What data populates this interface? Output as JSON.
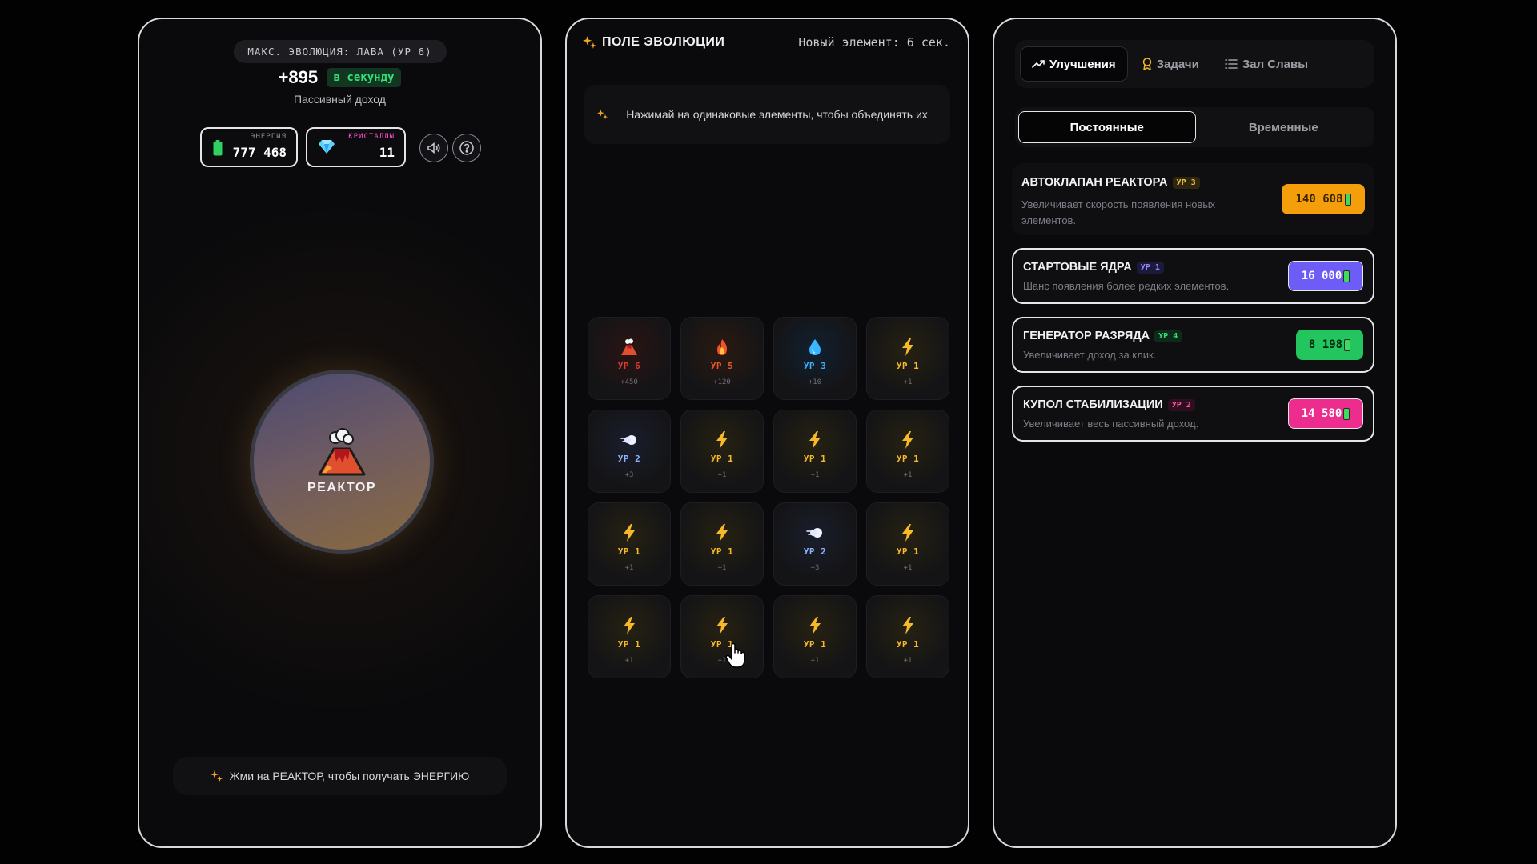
{
  "left": {
    "max_evolution": "МАКС. ЭВОЛЮЦИЯ: ЛАВА (УР 6)",
    "rate_value": "+895",
    "rate_badge": "в секунду",
    "passive_label": "Пассивный доход",
    "energy": {
      "label": "ЭНЕРГИЯ",
      "value": "777 468",
      "icon": "battery-icon"
    },
    "crystals": {
      "label": "КРИСТАЛЛЫ",
      "value": "11",
      "icon": "diamond-icon"
    },
    "reactor_label": "РЕАКТОР",
    "reactor_icon": "volcano-icon",
    "hint": "Жми на РЕАКТОР, чтобы получать ЭНЕРГИЮ"
  },
  "mid": {
    "title": "ПОЛЕ ЭВОЛЮЦИИ",
    "timer": "Новый элемент: 6 сек.",
    "hint": "Нажимай на одинаковые элементы, чтобы объединять их",
    "cells": [
      {
        "type": "lava",
        "level": "УР 6",
        "inc": "+450"
      },
      {
        "type": "fire",
        "level": "УР 5",
        "inc": "+120"
      },
      {
        "type": "water",
        "level": "УР 3",
        "inc": "+10"
      },
      {
        "type": "bolt",
        "level": "УР 1",
        "inc": "+1"
      },
      {
        "type": "wind",
        "level": "УР 2",
        "inc": "+3"
      },
      {
        "type": "bolt",
        "level": "УР 1",
        "inc": "+1"
      },
      {
        "type": "bolt",
        "level": "УР 1",
        "inc": "+1"
      },
      {
        "type": "bolt",
        "level": "УР 1",
        "inc": "+1"
      },
      {
        "type": "bolt",
        "level": "УР 1",
        "inc": "+1"
      },
      {
        "type": "bolt",
        "level": "УР 1",
        "inc": "+1"
      },
      {
        "type": "wind",
        "level": "УР 2",
        "inc": "+3"
      },
      {
        "type": "bolt",
        "level": "УР 1",
        "inc": "+1"
      },
      {
        "type": "bolt",
        "level": "УР 1",
        "inc": "+1"
      },
      {
        "type": "bolt",
        "level": "УР 1",
        "inc": "+1"
      },
      {
        "type": "bolt",
        "level": "УР 1",
        "inc": "+1"
      },
      {
        "type": "bolt",
        "level": "УР 1",
        "inc": "+1"
      }
    ]
  },
  "right": {
    "tabs": [
      "Улучшения",
      "Задачи",
      "Зал Славы"
    ],
    "segments": [
      "Постоянные",
      "Временные"
    ],
    "upgrades": [
      {
        "name": "АВТОКЛАПАН РЕАКТОРА",
        "level": "УР 3",
        "desc": "Увеличивает скорость появления новых элементов.",
        "price": "140 608",
        "color": "#f59e0b",
        "tag_color": "#f5c542"
      },
      {
        "name": "СТАРТОВЫЕ ЯДРА",
        "level": "УР 1",
        "desc": "Шанс появления более редких элементов.",
        "price": "16 000",
        "color": "#6d5cf6",
        "tag_color": "#8f86ff"
      },
      {
        "name": "ГЕНЕРАТОР РАЗРЯДА",
        "level": "УР 4",
        "desc": "Увеличивает доход за клик.",
        "price": "8 198",
        "color": "#22c55e",
        "tag_color": "#34e07a"
      },
      {
        "name": "КУПОЛ СТАБИЛИЗАЦИИ",
        "level": "УР 2",
        "desc": "Увеличивает весь пассивный доход.",
        "price": "14 580",
        "color": "#ec2d8e",
        "tag_color": "#ff4fa8"
      }
    ]
  },
  "colors": {
    "bolt": "#f5b92a",
    "lava": "#e23b2e",
    "fire": "#f0552a",
    "water": "#38b6ff",
    "wind": "#8fb4ff"
  }
}
